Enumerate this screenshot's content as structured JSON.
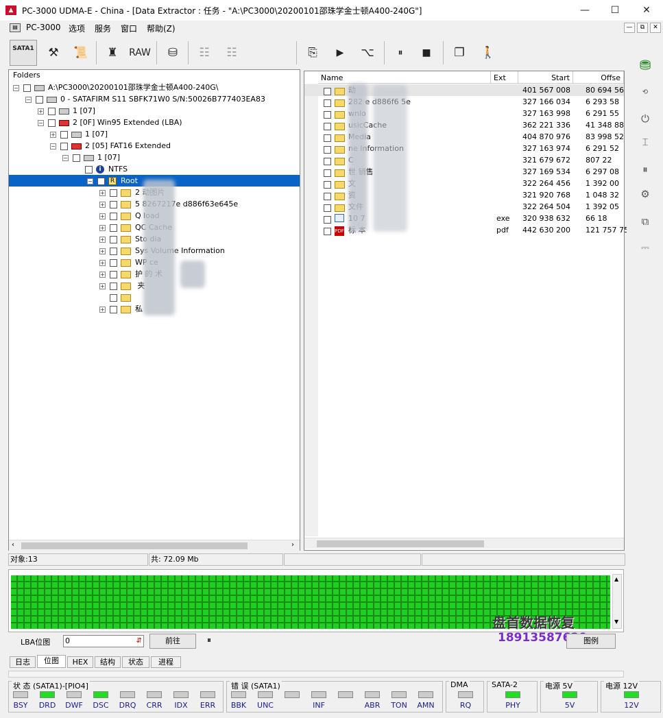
{
  "window": {
    "title": "PC-3000 UDMA-E - China - [Data Extractor : 任务 - \"A:\\PC3000\\20200101邵珠学金士顿A400-240G\"]",
    "minimize": "—",
    "maximize": "☐",
    "close": "✕"
  },
  "menu": {
    "items": [
      "PC-3000",
      "选项",
      "服务",
      "窗口",
      "帮助(Z)"
    ],
    "mdi": [
      "—",
      "⧉",
      "✕"
    ]
  },
  "toolbar": {
    "sata_label": "SATA1",
    "raw_label": "RAW"
  },
  "left_panel": {
    "header": "Folders",
    "tree": [
      {
        "label": "A:\\PC3000\\20200101邵珠学金士顿A400-240G\\",
        "indent": 0,
        "icon": "project-icon",
        "expander": "−"
      },
      {
        "label": "0 - SATAFIRM   S11 SBFK71W0 S/N:50026B777403EA83",
        "indent": 1,
        "icon": "drive-icon",
        "expander": "−"
      },
      {
        "label": "1 [07]",
        "indent": 2,
        "icon": "partition-icon",
        "expander": "+"
      },
      {
        "label": "2 [0F] Win95 Extended  (LBA)",
        "indent": 2,
        "icon": "partition-red-icon",
        "expander": "−"
      },
      {
        "label": "1 [07]",
        "indent": 3,
        "icon": "partition-icon",
        "expander": "+"
      },
      {
        "label": "2 [05] FAT16 Extended",
        "indent": 3,
        "icon": "partition-red-icon",
        "expander": "−"
      },
      {
        "label": "1 [07]",
        "indent": 4,
        "icon": "partition-icon",
        "expander": "−"
      },
      {
        "label": "NTFS",
        "indent": 5,
        "icon": "info-icon",
        "expander": ""
      },
      {
        "label": "Root",
        "indent": 6,
        "icon": "root-icon",
        "expander": "−",
        "selected": true
      },
      {
        "label": "2   动图片",
        "indent": 7,
        "icon": "folder-icon",
        "expander": "+"
      },
      {
        "label": "5   8267217e     d886f63e645e",
        "indent": 7,
        "icon": "folder-icon",
        "expander": "+"
      },
      {
        "label": "Q        load",
        "indent": 7,
        "icon": "folder-icon",
        "expander": "+"
      },
      {
        "label": "QC      Cache",
        "indent": 7,
        "icon": "folder-icon",
        "expander": "+"
      },
      {
        "label": "Sto    dia",
        "indent": 7,
        "icon": "folder-icon",
        "expander": "+"
      },
      {
        "label": "Sys    Volume Information",
        "indent": 7,
        "icon": "folder-icon",
        "expander": "+"
      },
      {
        "label": "WP       ce",
        "indent": 7,
        "icon": "folder-icon",
        "expander": "+"
      },
      {
        "label": "护      的     术",
        "indent": 7,
        "icon": "folder-icon",
        "expander": "+"
      },
      {
        "label": "        夹",
        "indent": 7,
        "icon": "folder-icon",
        "expander": "+"
      },
      {
        "label": "",
        "indent": 7,
        "icon": "folder-icon",
        "expander": ""
      },
      {
        "label": "私",
        "indent": 7,
        "icon": "folder-icon",
        "expander": "+"
      }
    ]
  },
  "right_panel": {
    "columns": [
      "Name",
      "Ext",
      "Start",
      "Offse"
    ],
    "rows": [
      {
        "name": "       动",
        "ext": "",
        "start": "401 567 008",
        "offset": "80 694 56",
        "icon": "folder-icon"
      },
      {
        "name": "   282      e      d886f6     5e",
        "ext": "",
        "start": "327 166 034",
        "offset": "6 293 58",
        "icon": "folder-icon"
      },
      {
        "name": "    wnlo",
        "ext": "",
        "start": "327 163 998",
        "offset": "6 291 55",
        "icon": "folder-icon"
      },
      {
        "name": "    usicCache",
        "ext": "",
        "start": "362 221 336",
        "offset": "41 348 88",
        "icon": "folder-icon"
      },
      {
        "name": "    Media",
        "ext": "",
        "start": "404 870 976",
        "offset": "83 998 52",
        "icon": "folder-icon"
      },
      {
        "name": "              ne Information",
        "ext": "",
        "start": "327 163 974",
        "offset": "6 291 52",
        "icon": "folder-icon"
      },
      {
        "name": "    C",
        "ext": "",
        "start": "321 679 672",
        "offset": "807 22",
        "icon": "folder-icon"
      },
      {
        "name": "    世       销售",
        "ext": "",
        "start": "327 169 534",
        "offset": "6 297 08",
        "icon": "folder-icon"
      },
      {
        "name": "    文",
        "ext": "",
        "start": "322 264 456",
        "offset": "1 392 00",
        "icon": "folder-icon"
      },
      {
        "name": "    资",
        "ext": "",
        "start": "321 920 768",
        "offset": "1 048 32",
        "icon": "folder-icon"
      },
      {
        "name": "    文件",
        "ext": "",
        "start": "322 264 504",
        "offset": "1 392 05",
        "icon": "folder-icon"
      },
      {
        "name": "    10        7",
        "ext": "exe",
        "start": "320 938 632",
        "offset": "66 18",
        "icon": "exe-icon"
      },
      {
        "name": "    标    本",
        "ext": "pdf",
        "start": "442 630 200",
        "offset": "121 757 75",
        "icon": "pdf-icon"
      }
    ]
  },
  "status": {
    "objects": "对象:13",
    "total": "共: 72.09 Mb"
  },
  "lba": {
    "label": "LBA位图",
    "value": "0",
    "goto": "前往",
    "pause": "⏸",
    "legend": "图例"
  },
  "watermark": {
    "line1": "盘首数据恢复",
    "line2": "18913587620"
  },
  "tabs": [
    "日志",
    "位图",
    "HEX",
    "结构",
    "状态",
    "进程"
  ],
  "indicators": {
    "status_title": "状 态 (SATA1)-[PIO4]",
    "status_leds": [
      {
        "label": "BSY",
        "on": false
      },
      {
        "label": "DRD",
        "on": true
      },
      {
        "label": "DWF",
        "on": false
      },
      {
        "label": "DSC",
        "on": true
      },
      {
        "label": "DRQ",
        "on": false
      },
      {
        "label": "CRR",
        "on": false
      },
      {
        "label": "IDX",
        "on": false
      },
      {
        "label": "ERR",
        "on": false
      }
    ],
    "error_title": "错 误 (SATA1)",
    "error_leds": [
      {
        "label": "BBK",
        "on": false
      },
      {
        "label": "UNC",
        "on": false
      },
      {
        "label": "",
        "on": false
      },
      {
        "label": "INF",
        "on": false
      },
      {
        "label": "",
        "on": false
      },
      {
        "label": "ABR",
        "on": false
      },
      {
        "label": "TON",
        "on": false
      },
      {
        "label": "AMN",
        "on": false
      }
    ],
    "dma_title": "DMA",
    "dma_led": "RQ",
    "sata2_title": "SATA-2",
    "sata2_led": "PHY",
    "power5_title": "电源 5V",
    "power5_led": "5V",
    "power12_title": "电源 12V",
    "power12_led": "12V"
  }
}
